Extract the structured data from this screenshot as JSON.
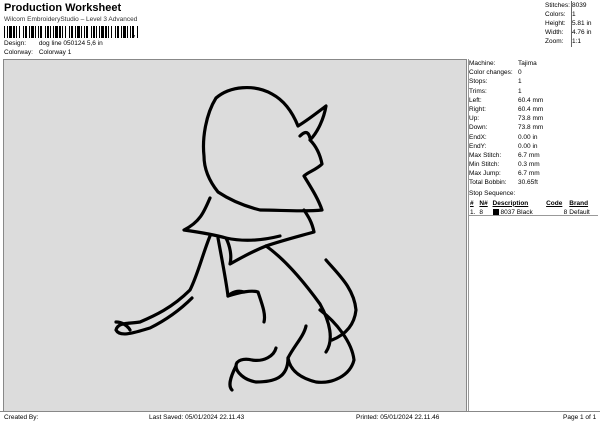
{
  "header": {
    "title": "Production Worksheet",
    "subtitle": "Wilcom EmbroideryStudio – Level 3 Advanced",
    "barcode_suffix": ",",
    "design_label": "Design:",
    "design_value": "dog line 050124 5,6 in",
    "colorway_label": "Colorway:",
    "colorway_value": "Colorway 1"
  },
  "top_stats": [
    {
      "label": "Stitches:",
      "value": "8039"
    },
    {
      "label": "Colors:",
      "value": "1"
    },
    {
      "label": "Height:",
      "value": "5.81 in"
    },
    {
      "label": "Width:",
      "value": "4.76 in"
    },
    {
      "label": "Zoom:",
      "value": "1:1"
    }
  ],
  "machine_info": [
    {
      "label": "Machine:",
      "value": "Tajima"
    },
    {
      "label": "Color changes:",
      "value": "0"
    },
    {
      "label": "Stops:",
      "value": "1"
    },
    {
      "label": "Trims:",
      "value": "1"
    },
    {
      "label": "Left:",
      "value": "60.4 mm"
    },
    {
      "label": "Right:",
      "value": "60.4 mm"
    },
    {
      "label": "Up:",
      "value": "73.8 mm"
    },
    {
      "label": "Down:",
      "value": "73.8 mm"
    },
    {
      "label": "EndX:",
      "value": "0.00 in"
    },
    {
      "label": "EndY:",
      "value": "0.00 in"
    },
    {
      "label": "Max Stitch:",
      "value": "6.7 mm"
    },
    {
      "label": "Min Stitch:",
      "value": "0.3 mm"
    },
    {
      "label": "Max Jump:",
      "value": "6.7 mm"
    },
    {
      "label": "Total Bobbin:",
      "value": "30.65ft"
    }
  ],
  "stop_sequence": {
    "label": "Stop Sequence:",
    "headers": [
      "#",
      "N#",
      "Description",
      "Code",
      "Brand"
    ],
    "rows": [
      {
        "num": "1.",
        "n": "8",
        "code_color": "8037",
        "description": "Black",
        "code": "8",
        "brand": "Default"
      }
    ]
  },
  "footer": {
    "created_by": "Created By:",
    "last_saved": "Last Saved: 05/01/2024 22.11.43",
    "printed": "Printed: 05/01/2024 22.11.46",
    "page": "Page 1 of 1"
  },
  "colors": {
    "canvas_bg": "#dcdcdc",
    "thread": "#000000"
  }
}
